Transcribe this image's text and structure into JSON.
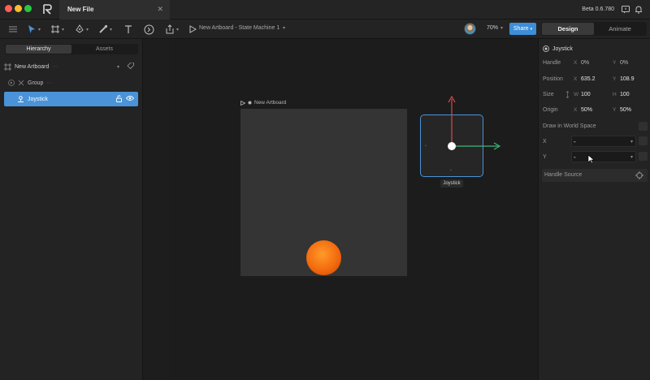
{
  "window": {
    "tab_title": "New File",
    "tab_close": "✕",
    "version": "Beta 0.6.780"
  },
  "toolbar": {
    "state_machine_label": "New Artboard - State Machine 1",
    "zoom": "70%",
    "share_label": "Share",
    "modes": {
      "design": "Design",
      "animate": "Animate"
    }
  },
  "left_panel": {
    "tabs": {
      "hierarchy": "Hierarchy",
      "assets": "Assets"
    },
    "tree": [
      {
        "label": "New Artboard",
        "icon": "artboard-icon"
      },
      {
        "label": "Group",
        "icon": "group-icon"
      },
      {
        "label": "Joystick",
        "icon": "joystick-icon",
        "selected": true
      }
    ]
  },
  "canvas": {
    "artboard_label": "New Artboard",
    "joystick_label": "Joystick"
  },
  "inspector": {
    "title": "Joystick",
    "handle": {
      "label": "Handle",
      "x_axis": "X",
      "x": "0%",
      "y_axis": "Y",
      "y": "0%"
    },
    "position": {
      "label": "Position",
      "x_axis": "X",
      "x": "635.2",
      "y_axis": "Y",
      "y": "108.9"
    },
    "size": {
      "label": "Size",
      "w_axis": "W",
      "w": "100",
      "h_axis": "H",
      "h": "100"
    },
    "origin": {
      "label": "Origin",
      "x_axis": "X",
      "x": "50%",
      "y_axis": "Y",
      "y": "50%"
    },
    "draw_world_label": "Draw in World Space",
    "x_label": "X",
    "x_value": "-",
    "y_label": "Y",
    "y_value": "-",
    "handle_source_label": "Handle Source"
  },
  "colors": {
    "accent": "#4a93d8",
    "share": "#3d8ed9",
    "gizmo_x": "#3cb878",
    "gizmo_y": "#d84a4a",
    "ball": "#f36b0e"
  }
}
